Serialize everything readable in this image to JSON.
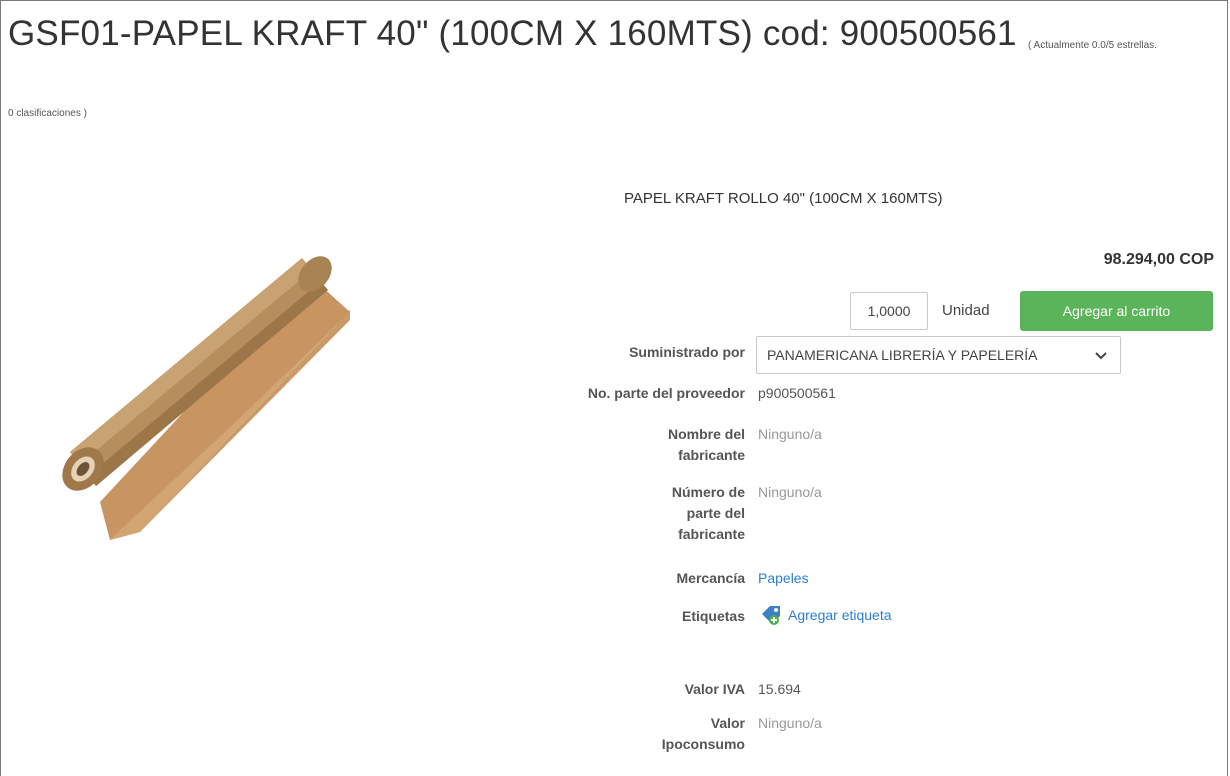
{
  "product": {
    "title": "GSF01-PAPEL KRAFT 40\" (100CM X 160MTS) cod: 900500561",
    "rating_line1": "( Actualmente 0.0/5 estrellas.",
    "rating_line2": "0 clasificaciones )",
    "image_icon": "kraft-paper-roll",
    "description": "PAPEL KRAFT ROLLO 40\" (100CM X 160MTS)",
    "price": "98.294,00 COP"
  },
  "purchase": {
    "quantity": "1,0000",
    "unit": "Unidad",
    "add_to_cart_label": "Agregar al carrito",
    "button_color": "#5cb45a"
  },
  "details": {
    "supplier_label": "Suministrado por",
    "supplier_value": "PANAMERICANA LIBRERÍA Y PAPELERÍA",
    "supplier_part_label": "No. parte del proveedor",
    "supplier_part_value": "p900500561",
    "manufacturer_label_1": "Nombre del",
    "manufacturer_label_2": "fabricante",
    "manufacturer_value": "Ninguno/a",
    "mfr_part_label_1": "Número de",
    "mfr_part_label_2": "parte del",
    "mfr_part_label_3": "fabricante",
    "mfr_part_value": "Ninguno/a",
    "commodity_label": "Mercancía",
    "commodity_value": "Papeles",
    "tags_label": "Etiquetas",
    "add_tag_label": "Agregar etiqueta",
    "iva_label": "Valor IVA",
    "iva_value": "15.694",
    "ipoconsumo_label_1": "Valor",
    "ipoconsumo_label_2": "Ipoconsumo",
    "ipoconsumo_value": "Ninguno/a",
    "link_color": "#2a7fd4"
  }
}
